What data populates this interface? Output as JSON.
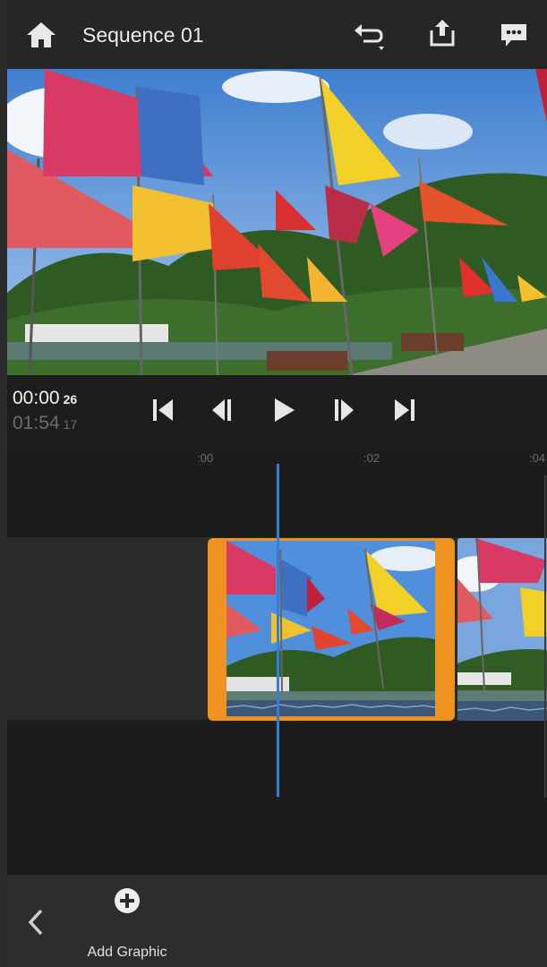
{
  "header": {
    "title": "Sequence 01",
    "icons": [
      "home-icon",
      "undo-icon",
      "share-icon",
      "feedback-icon"
    ]
  },
  "transport": {
    "current_time": "00:00",
    "current_frames": "26",
    "total_time": "01:54",
    "total_frames": "17",
    "buttons": [
      "skip-to-start-icon",
      "step-back-icon",
      "play-icon",
      "step-forward-icon",
      "skip-to-end-icon"
    ]
  },
  "timeline": {
    "ruler": [
      ":00",
      ":02",
      ":04"
    ]
  },
  "toolbar": {
    "add_graphic_label": "Add Graphic"
  },
  "colors": {
    "accent_selection": "#f0921f",
    "playhead": "#2f7fe0",
    "background": "#1f1f1f"
  }
}
